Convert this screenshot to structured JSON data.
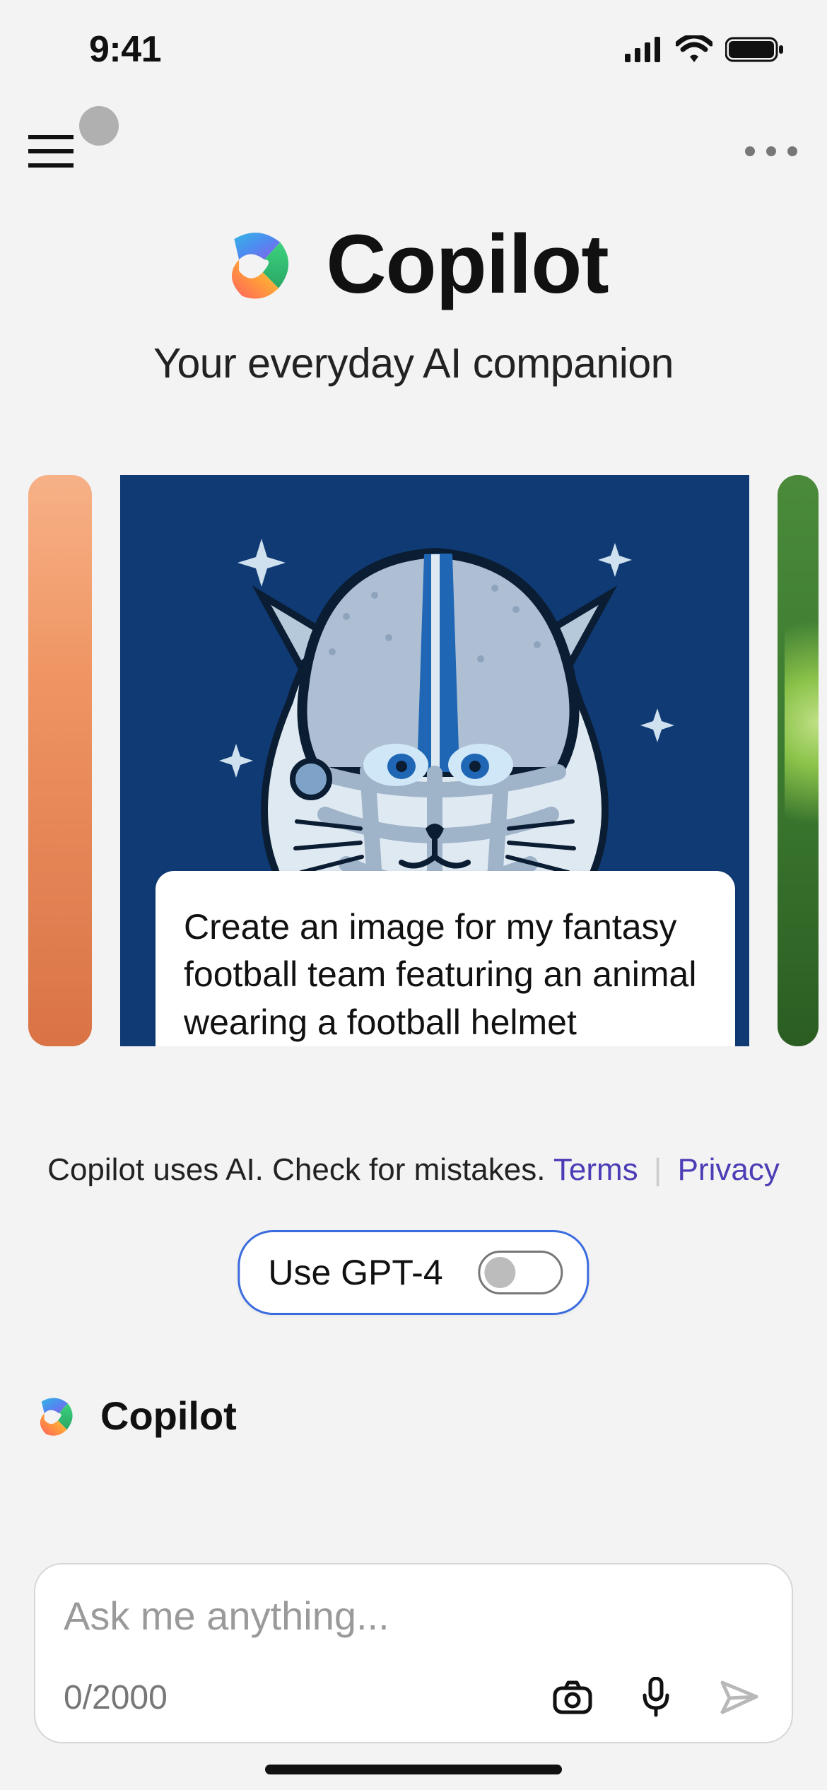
{
  "status_bar": {
    "time": "9:41"
  },
  "brand": {
    "title": "Copilot",
    "subtitle": "Your everyday AI companion"
  },
  "carousel": {
    "main_card_caption": "Create an image for my fantasy football team featuring an animal wearing a football helmet"
  },
  "disclaimer": {
    "text": "Copilot uses AI. Check for mistakes.",
    "terms_label": "Terms",
    "privacy_label": "Privacy"
  },
  "toggle": {
    "label": "Use GPT-4",
    "on": false
  },
  "chat": {
    "sender": "Copilot"
  },
  "composer": {
    "placeholder": "Ask me anything...",
    "char_count": "0/2000"
  }
}
